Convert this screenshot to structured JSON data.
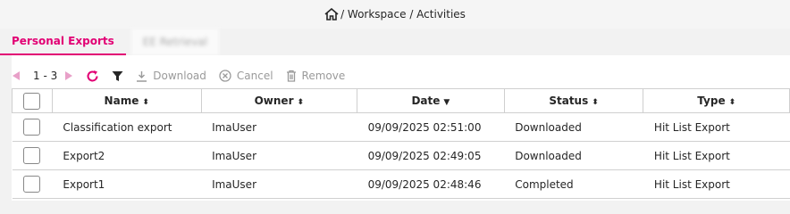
{
  "breadcrumb": {
    "text": "/ Workspace / Activities"
  },
  "tabs": [
    {
      "label": "Personal Exports",
      "active": true
    },
    {
      "label": "EE Retrieval",
      "active": false
    }
  ],
  "toolbar": {
    "range": "1 - 3",
    "download": "Download",
    "cancel": "Cancel",
    "remove": "Remove"
  },
  "table": {
    "columns": [
      {
        "label": "Name",
        "sort": "⬍"
      },
      {
        "label": "Owner",
        "sort": "⬍"
      },
      {
        "label": "Date",
        "sort": "▼"
      },
      {
        "label": "Status",
        "sort": "⬍"
      },
      {
        "label": "Type",
        "sort": "⬍"
      }
    ],
    "rows": [
      {
        "name": "Classification export",
        "owner": "ImaUser",
        "date": "09/09/2025 02:51:00",
        "status": "Downloaded",
        "type": "Hit List Export"
      },
      {
        "name": "Export2",
        "owner": "ImaUser",
        "date": "09/09/2025 02:49:05",
        "status": "Downloaded",
        "type": "Hit List Export"
      },
      {
        "name": "Export1",
        "owner": "ImaUser",
        "date": "09/09/2025 02:48:46",
        "status": "Completed",
        "type": "Hit List Export"
      }
    ]
  },
  "colors": {
    "accent": "#e20074",
    "disabled": "#9a9a9a"
  },
  "icons": [
    "home-icon",
    "prev-page-icon",
    "next-page-icon",
    "refresh-icon",
    "filter-icon",
    "download-icon",
    "cancel-icon",
    "trash-icon"
  ]
}
